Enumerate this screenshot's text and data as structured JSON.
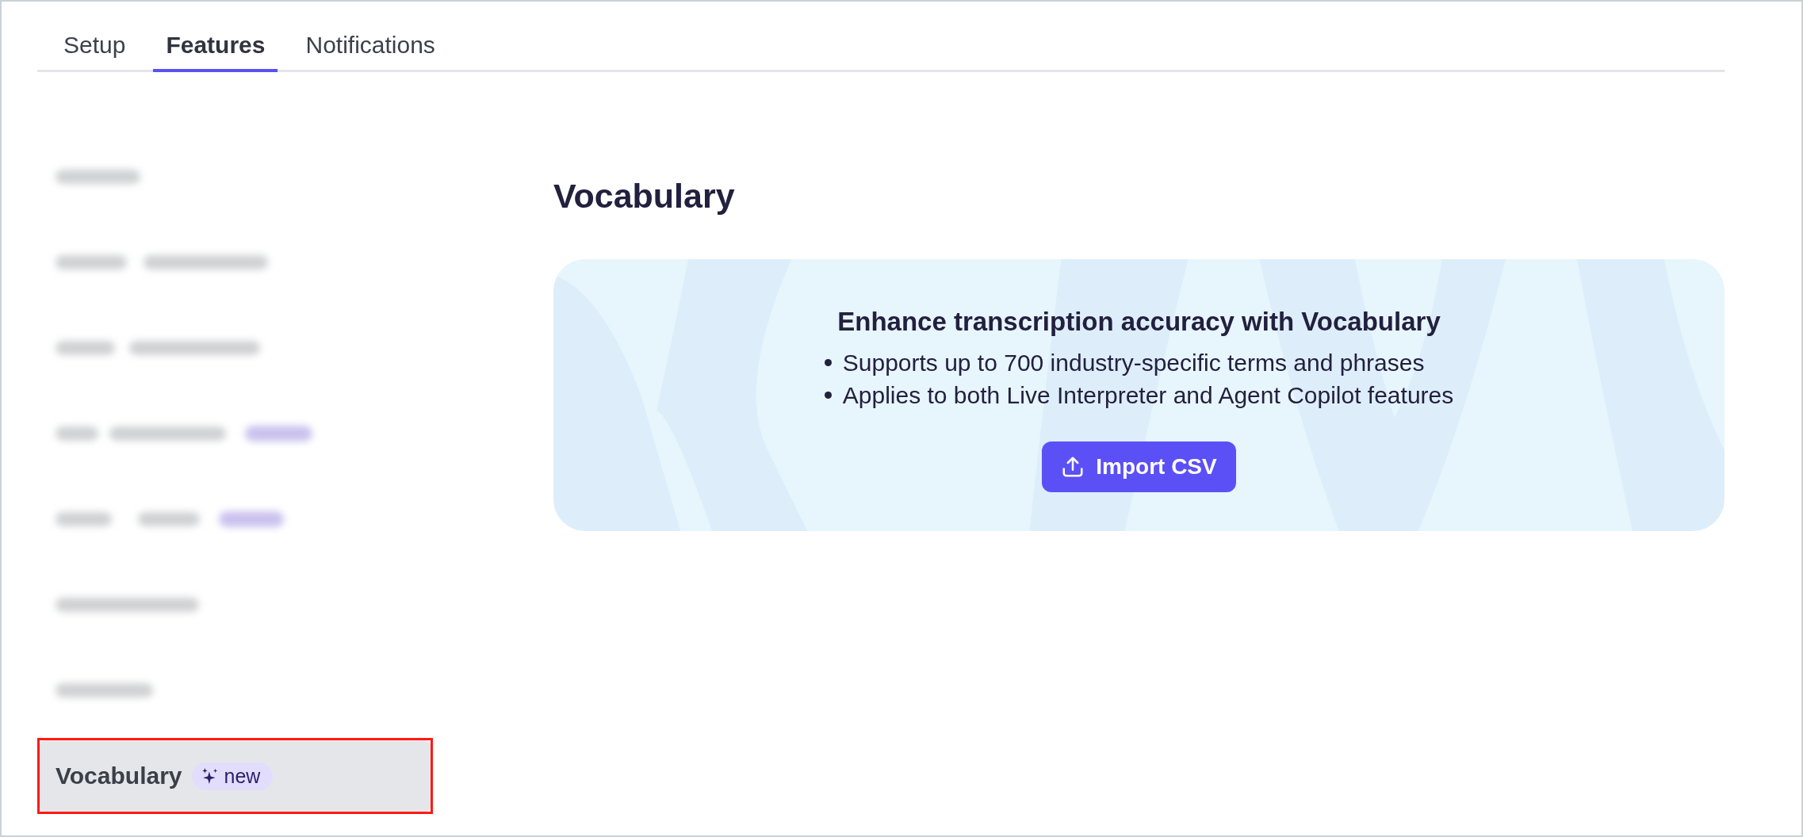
{
  "tabs": [
    {
      "label": "Setup",
      "selected": false
    },
    {
      "label": "Features",
      "selected": true
    },
    {
      "label": "Notifications",
      "selected": false
    }
  ],
  "sidebar": {
    "items": [
      {
        "kind": "blurred",
        "blurred_badge": false,
        "selected": false,
        "highlighted": false
      },
      {
        "kind": "blurred",
        "blurred_badge": false,
        "selected": false,
        "highlighted": false
      },
      {
        "kind": "blurred",
        "blurred_badge": false,
        "selected": false,
        "highlighted": false
      },
      {
        "kind": "blurred",
        "blurred_badge": true,
        "selected": false,
        "highlighted": false
      },
      {
        "kind": "blurred",
        "blurred_badge": true,
        "selected": false,
        "highlighted": false
      },
      {
        "kind": "blurred",
        "blurred_badge": false,
        "selected": false,
        "highlighted": false
      },
      {
        "kind": "blurred",
        "blurred_badge": false,
        "selected": false,
        "highlighted": false
      },
      {
        "kind": "label",
        "label": "Vocabulary",
        "badge": "new",
        "selected": true,
        "highlighted": true
      }
    ]
  },
  "main": {
    "title": "Vocabulary",
    "card": {
      "title": "Enhance transcription accuracy with Vocabulary",
      "bullets": [
        "Supports up to 700 industry-specific terms and phrases",
        "Applies to both Live Interpreter and Agent Copilot features"
      ],
      "button": {
        "label": "Import CSV"
      }
    }
  }
}
